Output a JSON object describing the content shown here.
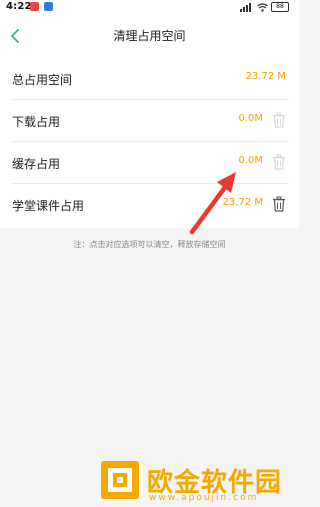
{
  "status_bar": {
    "time": "4:22",
    "battery": "88"
  },
  "header": {
    "title": "清理占用空间"
  },
  "storage": {
    "total_label": "总占用空间",
    "total_value": "23.72 M",
    "items": [
      {
        "label": "下载占用",
        "value": "0.0M",
        "icon": "trash-icon"
      },
      {
        "label": "缓存占用",
        "value": "0.0M",
        "icon": "trash-icon"
      },
      {
        "label": "学堂课件占用",
        "value": "23.72 M",
        "icon": "trash-icon"
      }
    ]
  },
  "note": "注：点击对应选项可以清空，释放存储空间",
  "watermark": {
    "text": "欧金软件园",
    "url": "www.apoujin.com"
  },
  "colors": {
    "value_orange": "#f0a300",
    "back_green": "#35b28a",
    "arrow_red": "#e8392f"
  }
}
